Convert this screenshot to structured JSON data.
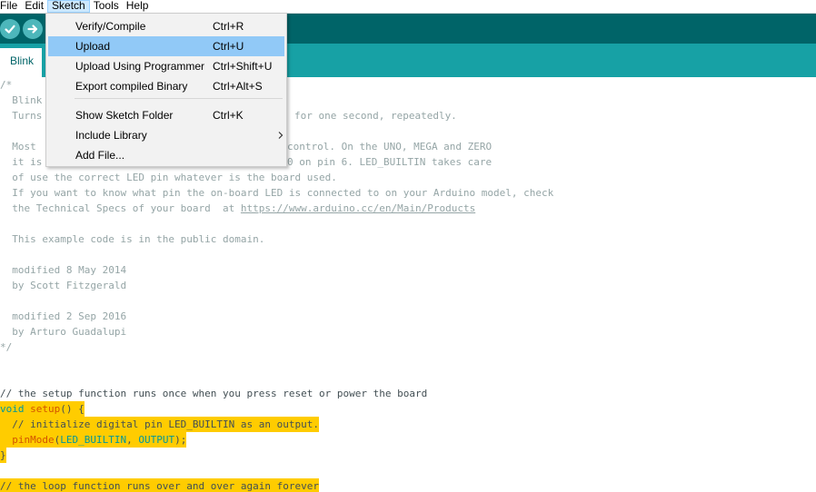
{
  "menubar": {
    "items": [
      {
        "label": "File"
      },
      {
        "label": "Edit"
      },
      {
        "label": "Sketch",
        "active": true
      },
      {
        "label": "Tools"
      },
      {
        "label": "Help"
      }
    ]
  },
  "toolbar": {
    "buttons": [
      {
        "icon": "checkmark-icon",
        "action": "verify"
      },
      {
        "icon": "arrow-right-icon",
        "action": "upload"
      }
    ]
  },
  "tabs": [
    {
      "label": "Blink"
    }
  ],
  "sketch_menu": {
    "items": [
      {
        "label": "Verify/Compile",
        "shortcut": "Ctrl+R"
      },
      {
        "label": "Upload",
        "shortcut": "Ctrl+U",
        "selected": true
      },
      {
        "label": "Upload Using Programmer",
        "shortcut": "Ctrl+Shift+U"
      },
      {
        "label": "Export compiled Binary",
        "shortcut": "Ctrl+Alt+S"
      },
      {
        "label": "Show Sketch Folder",
        "shortcut": "Ctrl+K"
      },
      {
        "label": "Include Library",
        "submenu": true
      },
      {
        "label": "Add File..."
      }
    ]
  },
  "editor": {
    "lines": {
      "l1": "/*",
      "l2": "  Blink",
      "l3": "  Turns",
      "l3b": "for one second, repeatedly.",
      "l5": "  Most",
      "l5b": "control. On the UNO, MEGA and ZERO",
      "l6": "  it is",
      "l6b": "0 on pin 6. LED_BUILTIN takes care",
      "l7": "  of use the correct LED pin whatever is the board used.",
      "l8": "  If you want to know what pin the on-board LED is connected to on your Arduino model, check",
      "l9a": "  the Technical Specs of your board  at ",
      "l9url": "https://www.arduino.cc/en/Main/Products",
      "l11": "  This example code is in the public domain.",
      "l13": "  modified 8 May 2014",
      "l14": "  by Scott Fitzgerald",
      "l16": "  modified 2 Sep 2016",
      "l17": "  by Arturo Guadalupi",
      "l18": "*/",
      "l21": "// the setup function runs once when you press reset or power the board",
      "l22kw": "void",
      "l22fn": "setup",
      "l22rest": "() {",
      "l23": "  // initialize digital pin LED_BUILTIN as an output.",
      "l24indent": "  ",
      "l24fn": "pinMode",
      "l24p1": "(",
      "l24a": "LED_BUILTIN",
      "l24p2": ", ",
      "l24b": "OUTPUT",
      "l24p3": ");",
      "l25": "}",
      "l27": "// the loop function runs over and over again forever"
    }
  },
  "colors": {
    "toolbar": "#006468",
    "tabstrip": "#17a1a5",
    "highlight": "#ffcc00",
    "menu_selected": "#91c9f7"
  }
}
